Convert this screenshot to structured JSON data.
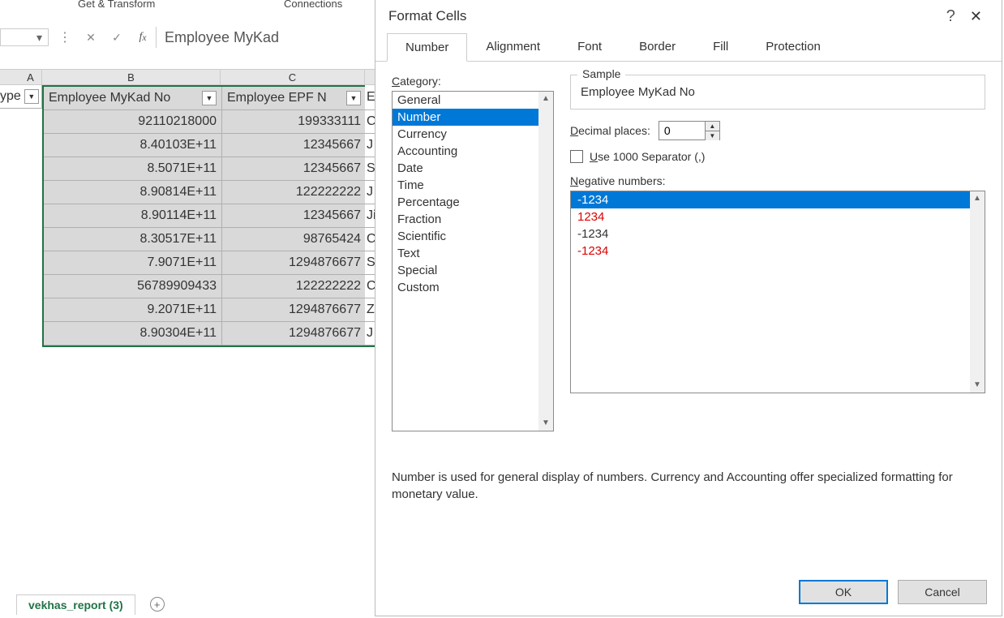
{
  "ribbon": {
    "group1": "Get & Transform",
    "group2": "Connections"
  },
  "formula_bar": {
    "content": "Employee MyKad"
  },
  "columns": {
    "a": "A",
    "b": "B",
    "c": "C"
  },
  "left_header": {
    "text": "ype",
    "filter": "▼"
  },
  "table": {
    "headers": {
      "b": "Employee MyKad No",
      "c": "Employee EPF N"
    },
    "rows": [
      {
        "b": "92110218000",
        "c": "199333111",
        "d": "C"
      },
      {
        "b": "8.40103E+11",
        "c": "12345667",
        "d": "J"
      },
      {
        "b": "8.5071E+11",
        "c": "12345667",
        "d": "S"
      },
      {
        "b": "8.90814E+11",
        "c": "122222222",
        "d": "J"
      },
      {
        "b": "8.90114E+11",
        "c": "12345667",
        "d": "Ji"
      },
      {
        "b": "8.30517E+11",
        "c": "98765424",
        "d": "C"
      },
      {
        "b": "7.9071E+11",
        "c": "1294876677",
        "d": "S"
      },
      {
        "b": "56789909433",
        "c": "122222222",
        "d": "C"
      },
      {
        "b": "9.2071E+11",
        "c": "1294876677",
        "d": "Z"
      },
      {
        "b": "8.90304E+11",
        "c": "1294876677",
        "d": "J"
      }
    ]
  },
  "sheet_tab": "vekhas_report (3)",
  "dialog": {
    "title": "Format Cells",
    "tabs": [
      "Number",
      "Alignment",
      "Font",
      "Border",
      "Fill",
      "Protection"
    ],
    "category_label": "Category:",
    "categories": [
      "General",
      "Number",
      "Currency",
      "Accounting",
      "Date",
      "Time",
      "Percentage",
      "Fraction",
      "Scientific",
      "Text",
      "Special",
      "Custom"
    ],
    "selected_category": "Number",
    "sample_label": "Sample",
    "sample_value": "Employee MyKad No",
    "decimal_label": "Decimal places:",
    "decimal_value": "0",
    "separator_label": "Use 1000 Separator (,)",
    "negative_label": "Negative numbers:",
    "negatives": [
      {
        "text": "-1234",
        "red": false,
        "selected": true
      },
      {
        "text": "1234",
        "red": true,
        "selected": false
      },
      {
        "text": "-1234",
        "red": false,
        "selected": false
      },
      {
        "text": "-1234",
        "red": true,
        "selected": false
      }
    ],
    "description": "Number is used for general display of numbers.  Currency and Accounting offer specialized formatting for monetary value.",
    "ok": "OK",
    "cancel": "Cancel"
  }
}
